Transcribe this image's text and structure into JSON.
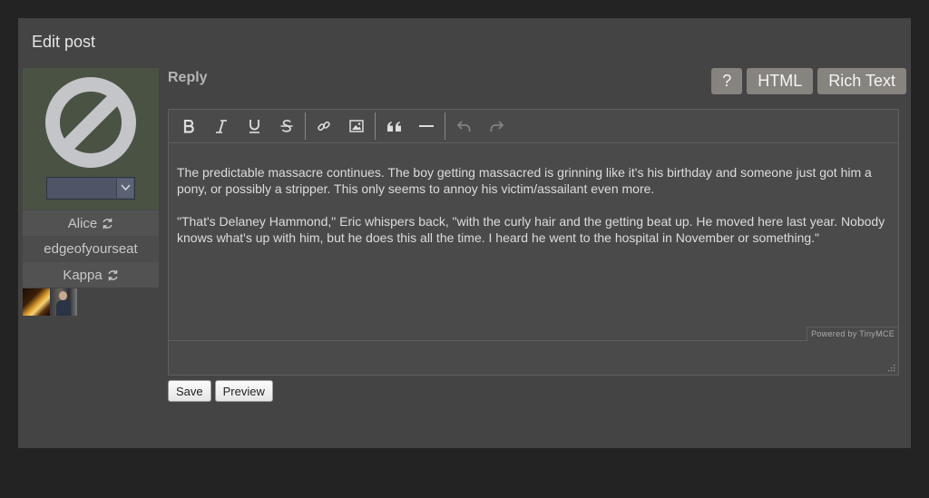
{
  "panel": {
    "title": "Edit post"
  },
  "sidebar": {
    "avatar_icon": "no-avatar-icon",
    "icon_select_value": "",
    "characters": [
      {
        "label": "Alice",
        "has_switch": true
      },
      {
        "label": "edgeofyourseat",
        "has_switch": false
      },
      {
        "label": "Kappa",
        "has_switch": true
      }
    ]
  },
  "reply": {
    "label": "Reply"
  },
  "mode_buttons": {
    "help": "?",
    "html": "HTML",
    "rich": "Rich Text"
  },
  "toolbar": {
    "icons": [
      "bold-icon",
      "italic-icon",
      "underline-icon",
      "strikethrough-icon",
      "link-icon",
      "image-icon",
      "blockquote-icon",
      "horizontal-rule-icon",
      "undo-icon",
      "redo-icon"
    ]
  },
  "editor": {
    "paragraphs": [
      "The predictable massacre continues. The boy getting massacred is grinning like it's his birthday and someone just got him a pony, or possibly a stripper. This only seems to annoy his victim/assailant even more.",
      "\"That's Delaney Hammond,\" Eric whispers back, \"with the curly hair and the getting beat up. He moved here last year. Nobody knows what's up with him, but he does this all the time. I heard he went to the hospital in November or something.\""
    ],
    "powered_by": "Powered by TinyMCE"
  },
  "actions": {
    "save": "Save",
    "preview": "Preview"
  },
  "colors": {
    "page_bg": "#232323",
    "panel_bg": "#444444",
    "mode_button": "#878480"
  }
}
